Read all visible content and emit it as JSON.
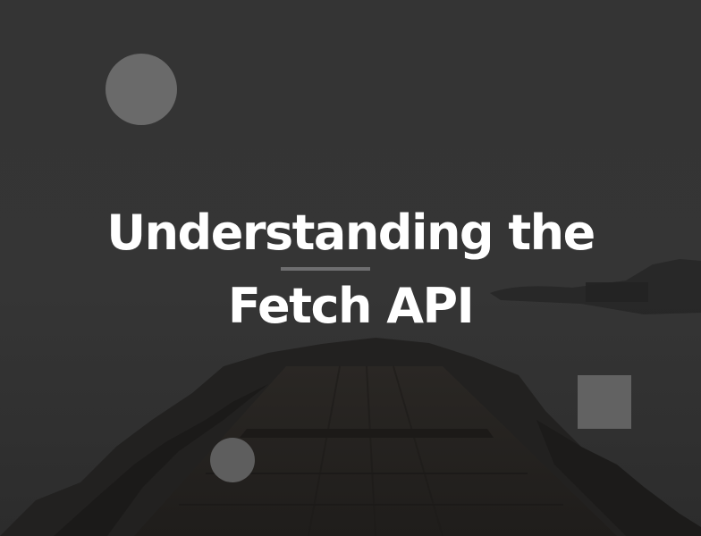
{
  "hero": {
    "title_line1": "Understanding the",
    "title_line2": "Fetch API"
  },
  "colors": {
    "background": "#333333",
    "title": "#ffffff",
    "divider": "#6e6e70",
    "decoration": "#666666"
  },
  "decorations": [
    "circle-large",
    "circle-small",
    "square"
  ]
}
